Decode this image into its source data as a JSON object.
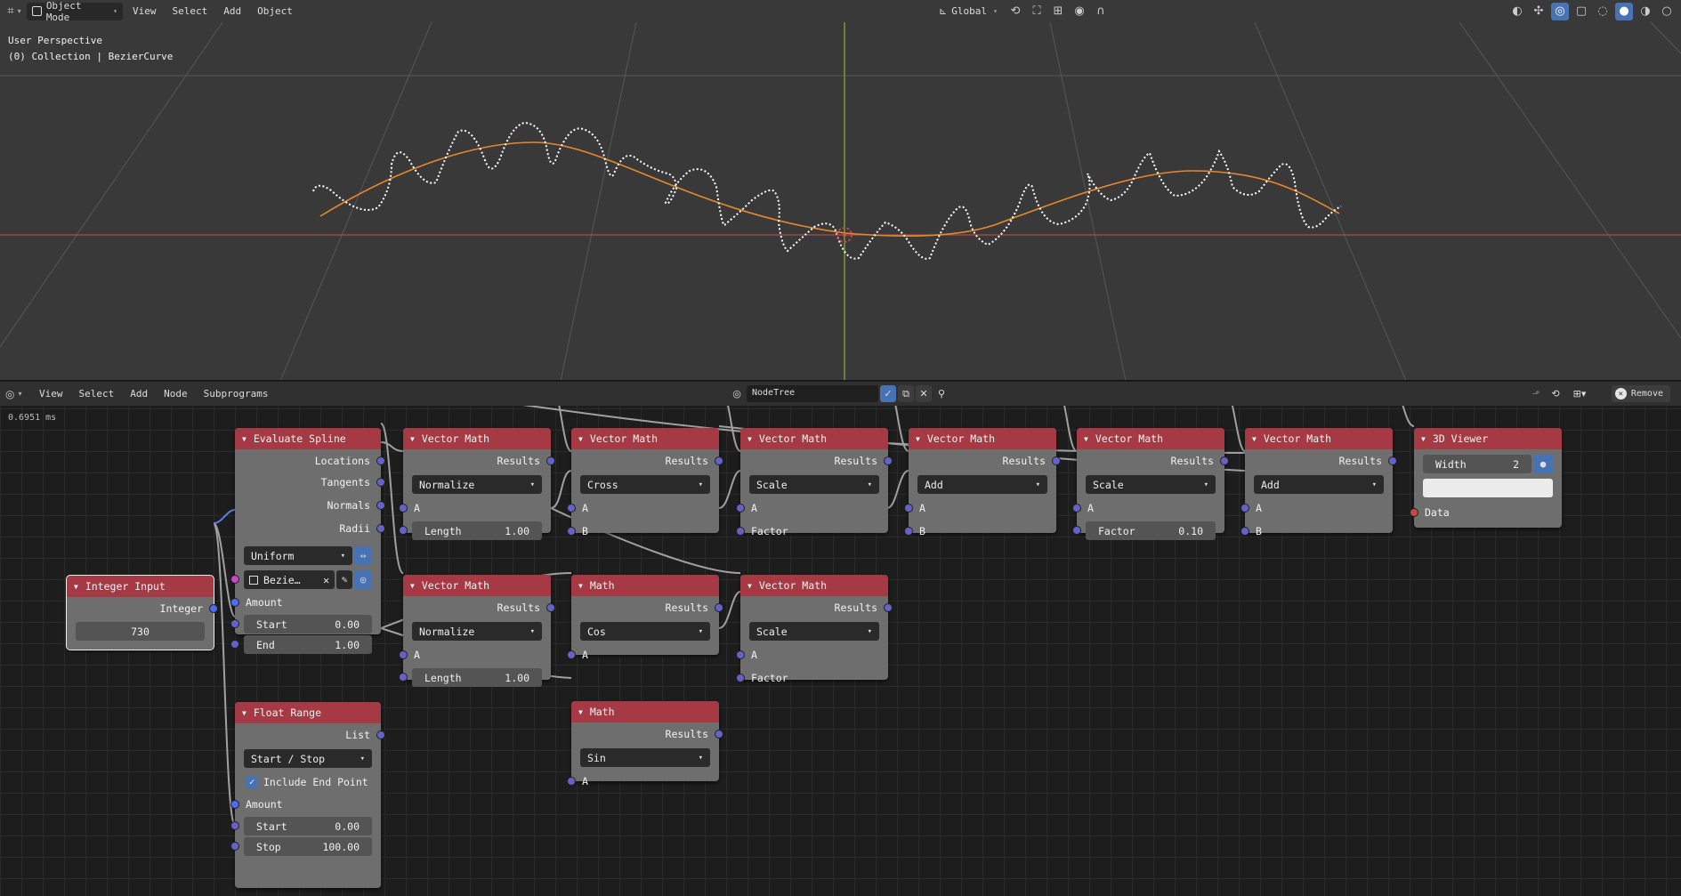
{
  "viewport": {
    "mode": "Object Mode",
    "menus": [
      "View",
      "Select",
      "Add",
      "Object"
    ],
    "transform_orientation": "Global",
    "info_line1": "User Perspective",
    "info_line2": "(0) Collection | BezierCurve"
  },
  "editor": {
    "menus": [
      "View",
      "Select",
      "Add",
      "Node",
      "Subprograms"
    ],
    "tree_name": "NodeTree",
    "remove_label": "Remove",
    "timing": "0.6951 ms"
  },
  "nodes": {
    "integer_input": {
      "title": "Integer Input",
      "out": "Integer",
      "value": "730"
    },
    "evaluate_spline": {
      "title": "Evaluate Spline",
      "out1": "Locations",
      "out2": "Tangents",
      "out3": "Normals",
      "out4": "Radii",
      "mode": "Uniform",
      "object": "Bezie…",
      "amount": "Amount",
      "start_label": "Start",
      "start_value": "0.00",
      "end_label": "End",
      "end_value": "1.00"
    },
    "float_range": {
      "title": "Float Range",
      "out": "List",
      "mode": "Start / Stop",
      "include": "Include End Point",
      "amount": "Amount",
      "start_label": "Start",
      "start_value": "0.00",
      "stop_label": "Stop",
      "stop_value": "100.00"
    },
    "vm1": {
      "title": "Vector Math",
      "out": "Results",
      "op": "Normalize",
      "in_a": "A",
      "len_label": "Length",
      "len_value": "1.00"
    },
    "vm2": {
      "title": "Vector Math",
      "out": "Results",
      "op": "Normalize",
      "in_a": "A",
      "len_label": "Length",
      "len_value": "1.00"
    },
    "vm3": {
      "title": "Vector Math",
      "out": "Results",
      "op": "Cross",
      "in_a": "A",
      "in_b": "B"
    },
    "math1": {
      "title": "Math",
      "out": "Results",
      "op": "Cos",
      "in_a": "A"
    },
    "math2": {
      "title": "Math",
      "out": "Results",
      "op": "Sin",
      "in_a": "A"
    },
    "vm4": {
      "title": "Vector Math",
      "out": "Results",
      "op": "Scale",
      "in_a": "A",
      "in_b": "Factor"
    },
    "vm5": {
      "title": "Vector Math",
      "out": "Results",
      "op": "Scale",
      "in_a": "A",
      "in_b": "Factor"
    },
    "vm6": {
      "title": "Vector Math",
      "out": "Results",
      "op": "Add",
      "in_a": "A",
      "in_b": "B"
    },
    "vm7": {
      "title": "Vector Math",
      "out": "Results",
      "op": "Scale",
      "in_a": "A",
      "fac_label": "Factor",
      "fac_value": "0.10"
    },
    "vm8": {
      "title": "Vector Math",
      "out": "Results",
      "op": "Add",
      "in_a": "A",
      "in_b": "B"
    },
    "viewer": {
      "title": "3D Viewer",
      "width_label": "Width",
      "width_value": "2",
      "in_data": "Data"
    }
  },
  "colors": {
    "node_header": "#a53a44",
    "node_body": "#6e6e6e",
    "vector_socket": "#6363c7",
    "curve": "#e8882a",
    "x_axis": "#b04b4b",
    "y_axis": "#8ab03b"
  }
}
